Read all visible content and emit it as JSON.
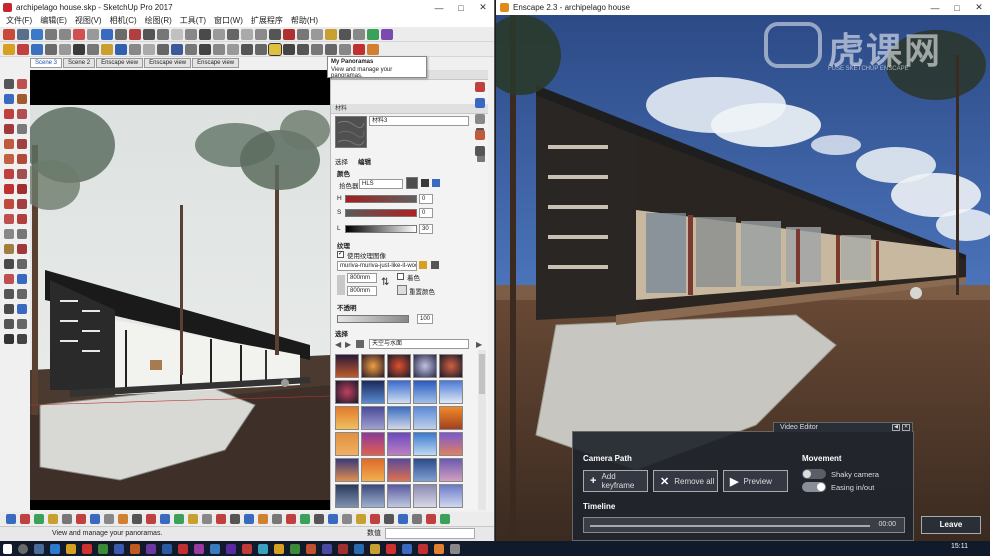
{
  "sketchup": {
    "title": "archipelago house.skp - SketchUp Pro 2017",
    "menu": [
      "文件(F)",
      "编辑(E)",
      "视图(V)",
      "相机(C)",
      "绘图(R)",
      "工具(T)",
      "窗口(W)",
      "扩展程序",
      "帮助(H)"
    ],
    "tooltip": {
      "title": "My Panoramas",
      "text": "View and manage your panoramas."
    },
    "scene_tabs": [
      "Scene 3",
      "Scene 2",
      "Enscape view",
      "Enscape view",
      "Enscape view"
    ],
    "active_scene": "Scene 3",
    "status_text": "View and manage your panoramas.",
    "measure_label": "数值"
  },
  "materials": {
    "panel_title": "材料",
    "material_name": "材料3",
    "tabs": [
      "选择",
      "编辑"
    ],
    "color_section": "颜色",
    "picker_label": "拾色器:",
    "picker_value": "HLS",
    "h_label": "H",
    "h_value": "0",
    "s_label": "S",
    "s_value": "0",
    "l_label": "L",
    "l_value": "30",
    "texture_section": "纹理",
    "use_texture_label": "使用纹理图像",
    "texture_file": "muriva-muriva-just-like-it-wood",
    "width_value": "800mm",
    "height_value": "800mm",
    "colorize_label": "着色",
    "reset_color_label": "重置颜色",
    "opacity_section": "不透明",
    "opacity_value": "100",
    "select_section": "选择",
    "library_value": "天空与水面"
  },
  "enscape": {
    "title": "Enscape 2.3 - archipelago house",
    "watermark": "虎课网",
    "watermark_sub": "FUSE SKETCHUP ENSCAPE",
    "video_editor": {
      "header": "Video Editor",
      "camera_path_title": "Camera Path",
      "add_keyframe": "Add keyframe",
      "remove_all": "Remove all",
      "preview": "Preview",
      "movement_title": "Movement",
      "shaky_camera": "Shaky camera",
      "easing": "Easing in/out",
      "timeline_title": "Timeline",
      "time": "00:00"
    },
    "leave": "Leave"
  },
  "taskbar": {
    "clock": "15:11"
  }
}
